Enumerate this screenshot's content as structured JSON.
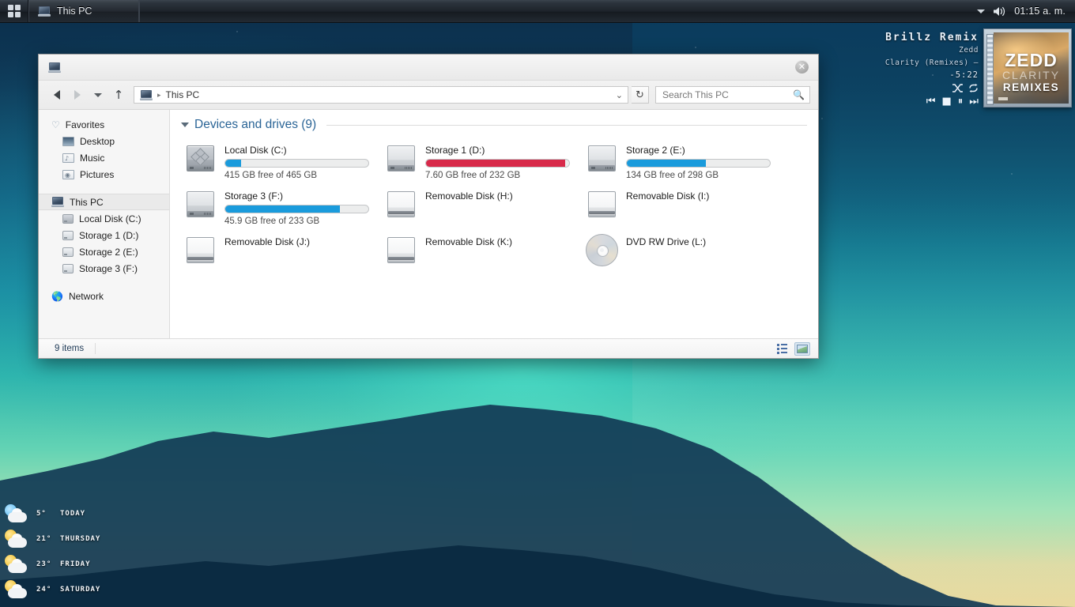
{
  "taskbar": {
    "start_icon": "app-grid-icon",
    "task_label": "This PC",
    "tray": {
      "chevron_icon": "chevron-up-icon",
      "volume_icon": "speaker-icon",
      "time": "01:15 a. m."
    }
  },
  "explorer": {
    "title_icon": "computer-icon",
    "close_label": "✕",
    "nav": {
      "back_label": "◀",
      "forward_label": "▶",
      "recent_label": "▾",
      "up_label": "↑",
      "address_crumb": "This PC",
      "address_sep": "▸",
      "address_dropdown": "⌄",
      "refresh_label": "↻"
    },
    "search": {
      "placeholder": "Search This PC",
      "value": "",
      "icon": "search-icon"
    },
    "sidebar": {
      "favorites": {
        "label": "Favorites",
        "icon": "heart-icon"
      },
      "desktop": {
        "label": "Desktop",
        "icon": "desktop-icon"
      },
      "music": {
        "label": "Music",
        "icon": "music-folder-icon"
      },
      "pictures": {
        "label": "Pictures",
        "icon": "camera-icon"
      },
      "this_pc": {
        "label": "This PC",
        "icon": "computer-icon"
      },
      "drive_c": {
        "label": "Local Disk (C:)",
        "icon": "hard-drive-icon"
      },
      "drive_d": {
        "label": "Storage 1 (D:)",
        "icon": "hard-drive-icon"
      },
      "drive_e": {
        "label": "Storage 2 (E:)",
        "icon": "hard-drive-icon"
      },
      "drive_f": {
        "label": "Storage 3 (F:)",
        "icon": "hard-drive-icon"
      },
      "network": {
        "label": "Network",
        "icon": "globe-icon"
      }
    },
    "group": {
      "title": "Devices and drives (9)",
      "collapse_icon": "triangle-down-icon"
    },
    "drives": [
      {
        "name": "Local Disk (C:)",
        "free_text": "415 GB free of 465 GB",
        "used_pct": 11,
        "bar_color": "#1a9bdc",
        "icon": "windows-drive-icon",
        "has_bar": true
      },
      {
        "name": "Storage 1 (D:)",
        "free_text": "7.60 GB free of 232 GB",
        "used_pct": 97,
        "bar_color": "#d82a4a",
        "icon": "hard-drive-icon",
        "has_bar": true
      },
      {
        "name": "Storage 2 (E:)",
        "free_text": "134 GB free of 298 GB",
        "used_pct": 55,
        "bar_color": "#1a9bdc",
        "icon": "hard-drive-icon",
        "has_bar": true
      },
      {
        "name": "Storage 3 (F:)",
        "free_text": "45.9 GB free of 233 GB",
        "used_pct": 80,
        "bar_color": "#1a9bdc",
        "icon": "hard-drive-icon",
        "has_bar": true
      },
      {
        "name": "Removable Disk (H:)",
        "free_text": "",
        "used_pct": 0,
        "bar_color": "",
        "icon": "removable-drive-icon",
        "has_bar": false
      },
      {
        "name": "Removable Disk (I:)",
        "free_text": "",
        "used_pct": 0,
        "bar_color": "",
        "icon": "removable-drive-icon",
        "has_bar": false
      },
      {
        "name": "Removable Disk (J:)",
        "free_text": "",
        "used_pct": 0,
        "bar_color": "",
        "icon": "removable-drive-icon",
        "has_bar": false
      },
      {
        "name": "Removable Disk (K:)",
        "free_text": "",
        "used_pct": 0,
        "bar_color": "",
        "icon": "removable-drive-icon",
        "has_bar": false
      },
      {
        "name": "DVD RW Drive (L:)",
        "free_text": "",
        "used_pct": 0,
        "bar_color": "",
        "icon": "optical-disc-icon",
        "has_bar": false
      }
    ],
    "status": {
      "item_count": "9 items",
      "details_view_icon": "list-view-icon",
      "icons_view_icon": "large-icons-view-icon"
    }
  },
  "music": {
    "title": "Brillz Remix",
    "artist": "Zedd",
    "album": "Clarity (Remixes) –",
    "time_remaining": "-5:22",
    "shuffle_icon": "shuffle-icon",
    "repeat_icon": "repeat-icon",
    "prev_label": "⏮",
    "stop_label": "■",
    "pause_label": "⏸",
    "next_label": "⏭",
    "art": {
      "line1": "ZEDD",
      "line2": "CLARITY",
      "line3": "REMIXES"
    }
  },
  "weather": [
    {
      "temp": "5°",
      "day": "TODAY",
      "icon": "moon-cloud-icon"
    },
    {
      "temp": "21°",
      "day": "THURSDAY",
      "icon": "sun-cloud-icon"
    },
    {
      "temp": "23°",
      "day": "FRIDAY",
      "icon": "sun-cloud-icon"
    },
    {
      "temp": "24°",
      "day": "SATURDAY",
      "icon": "sun-cloud-icon"
    }
  ]
}
